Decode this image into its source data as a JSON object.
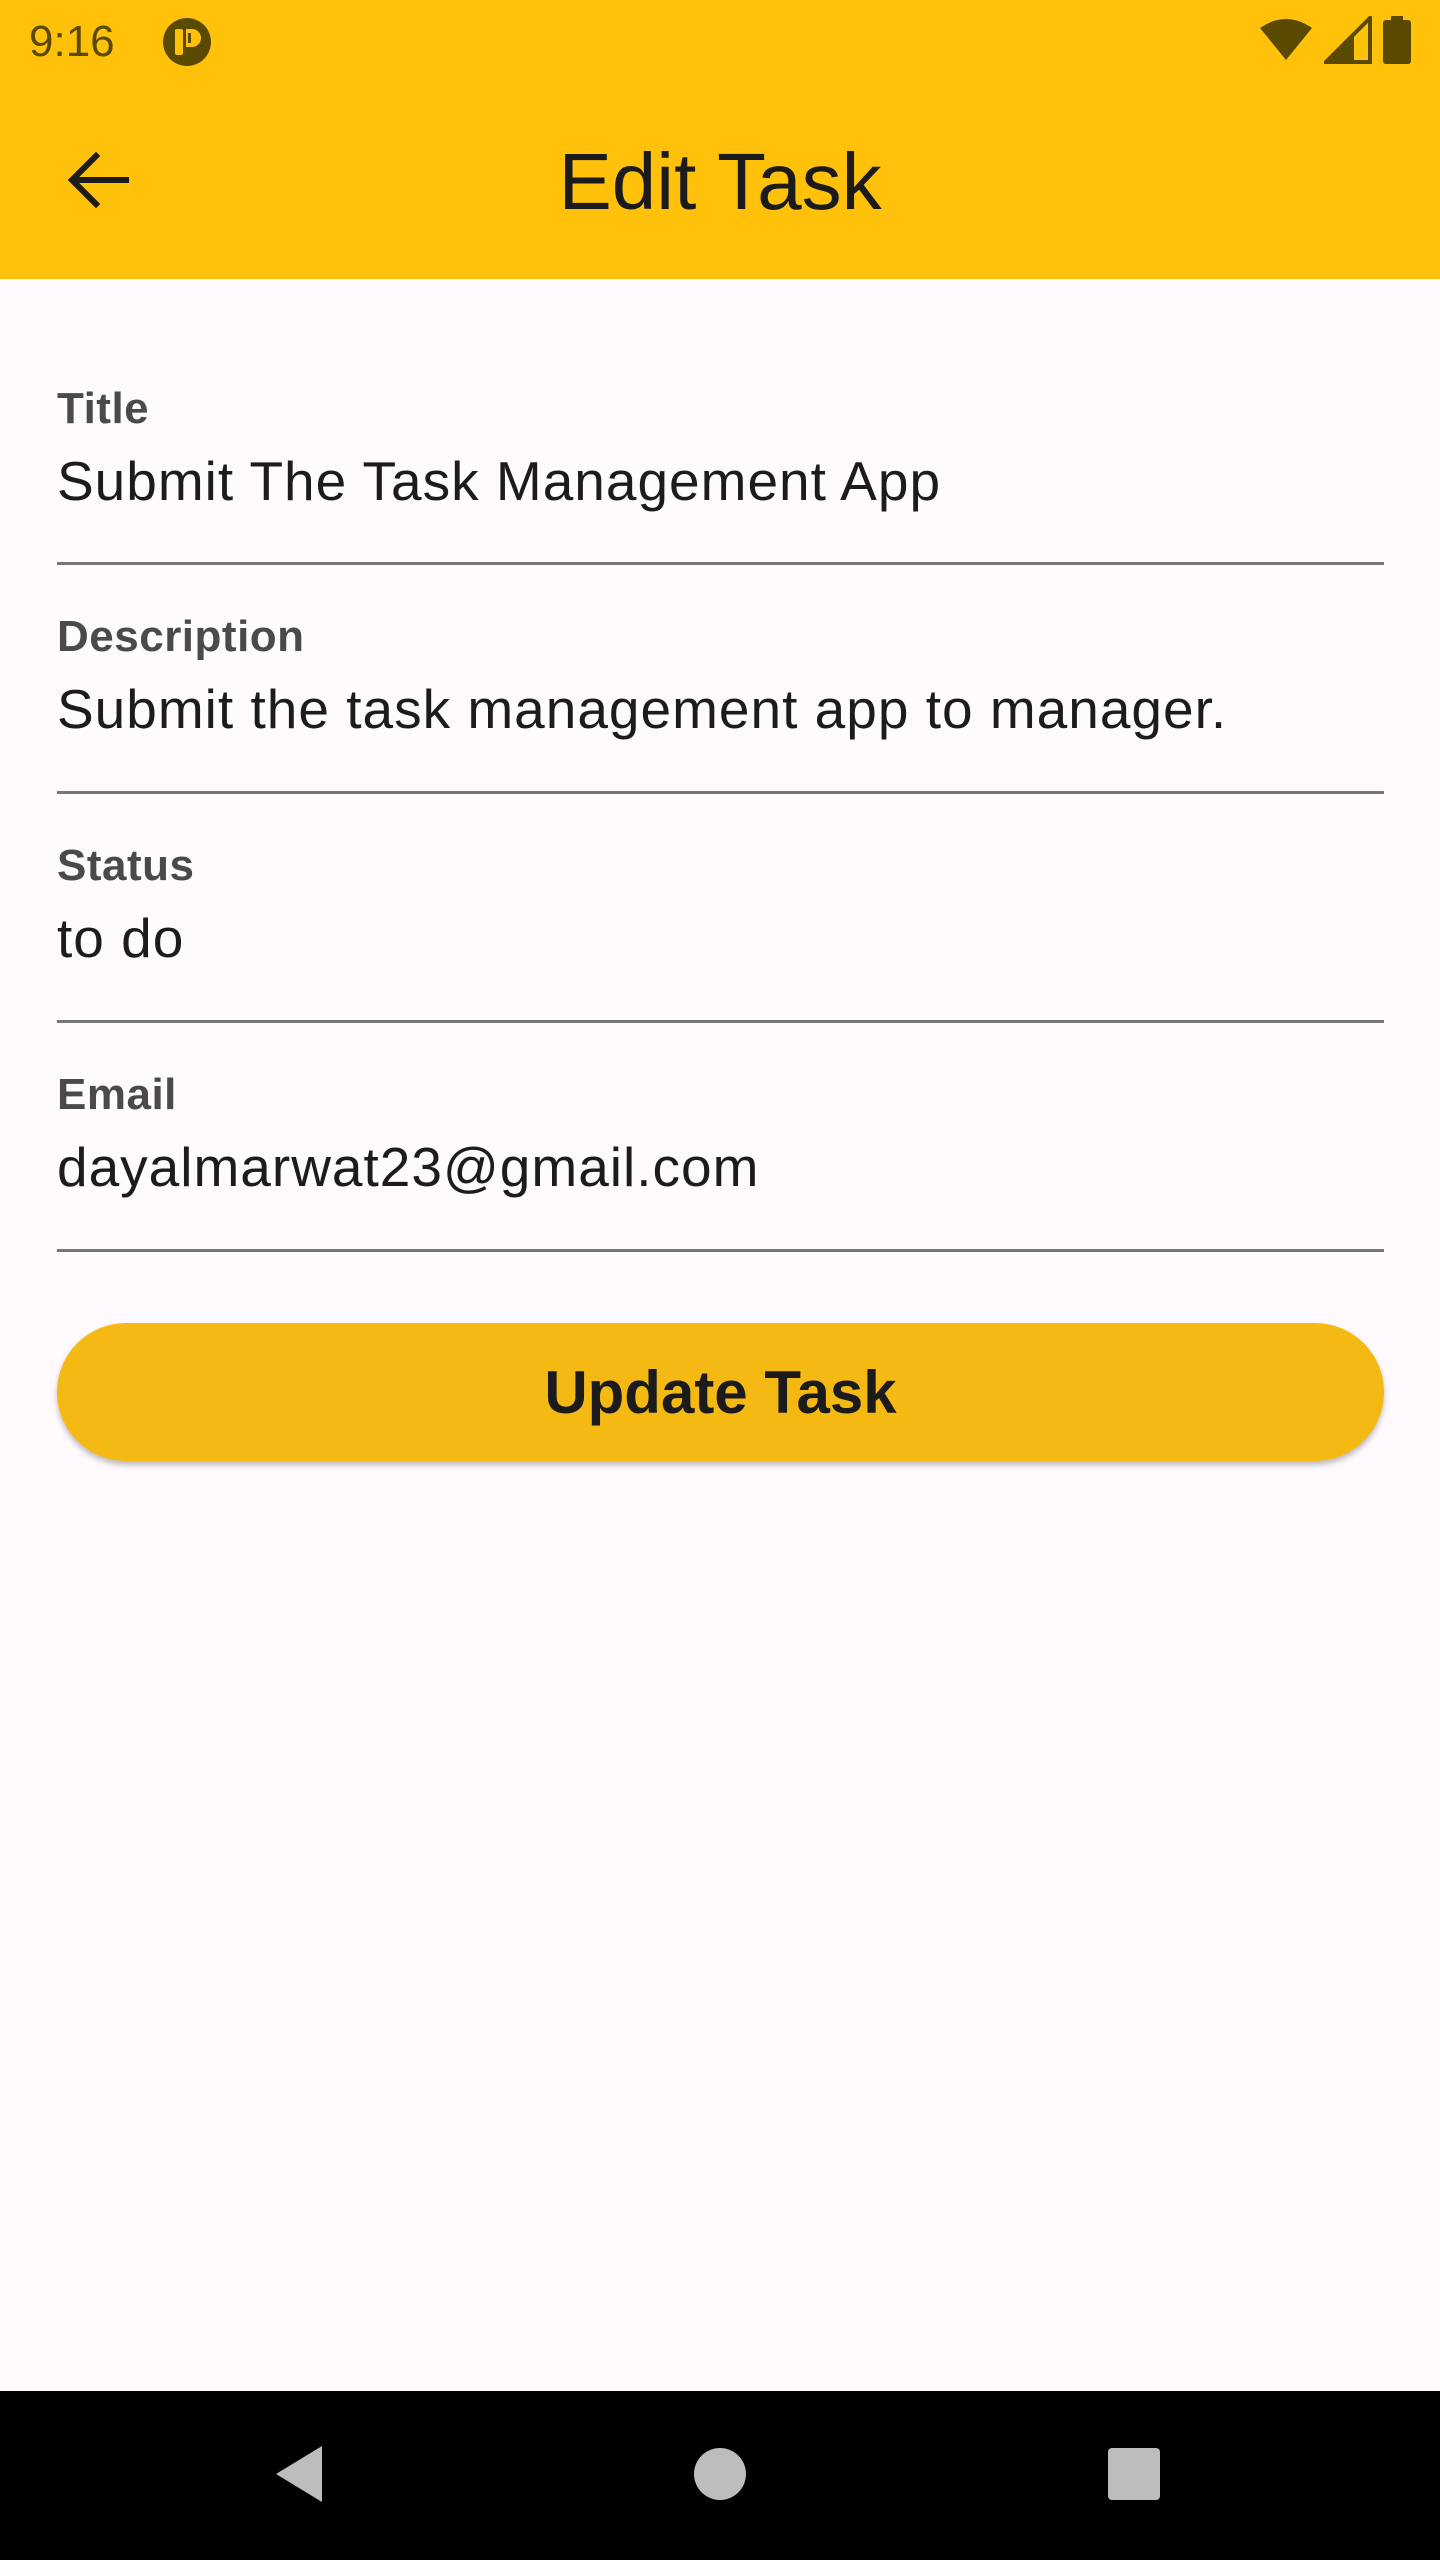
{
  "status_bar": {
    "time": "9:16",
    "icons": [
      "app-notification-icon",
      "wifi-icon",
      "signal-icon",
      "battery-icon"
    ]
  },
  "app_bar": {
    "title": "Edit Task",
    "back_icon": "arrow-back-icon",
    "background_color": "#FFC10A"
  },
  "form": {
    "title": {
      "label": "Title",
      "value": "Submit The Task Management App"
    },
    "description": {
      "label": "Description",
      "value": "Submit the task management app to manager."
    },
    "status": {
      "label": "Status",
      "value": "to do"
    },
    "email": {
      "label": "Email",
      "value": "dayalmarwat23@gmail.com"
    }
  },
  "update_button": {
    "label": "Update Task",
    "color": "#F5B913"
  },
  "nav_bar": {
    "icons": [
      "back-triangle-icon",
      "home-circle-icon",
      "recents-square-icon"
    ]
  }
}
